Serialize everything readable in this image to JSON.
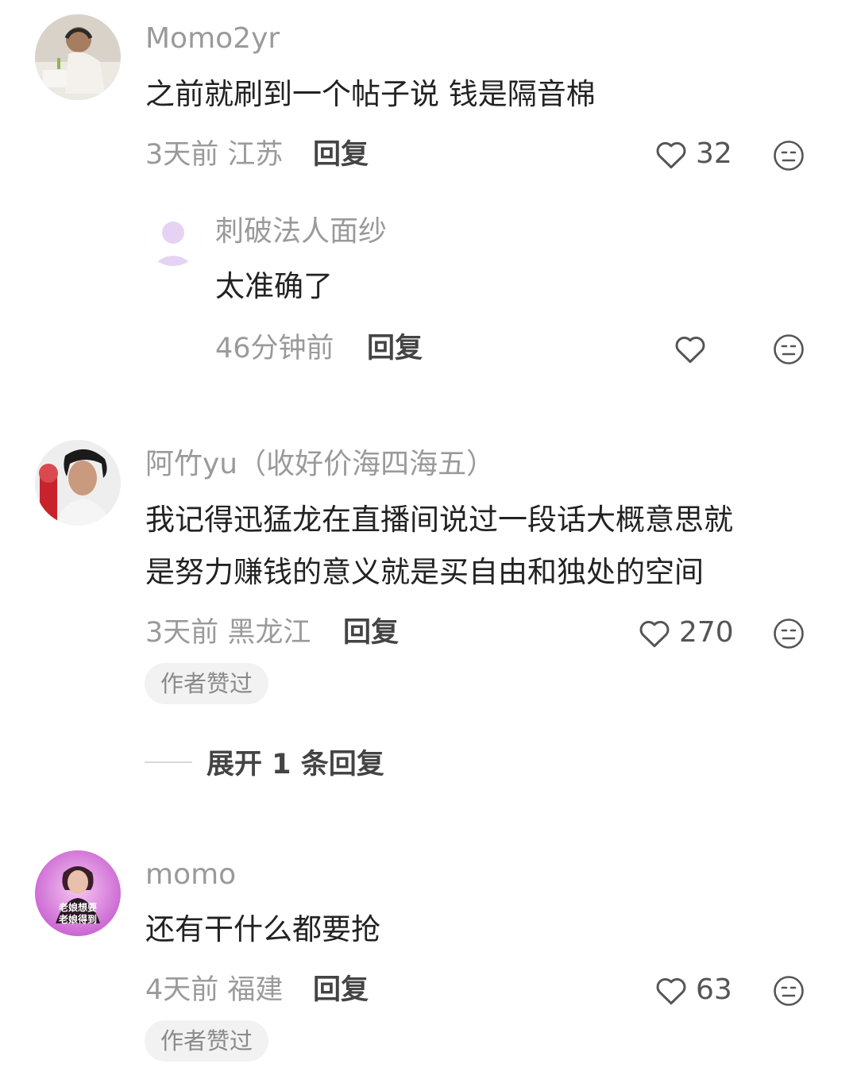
{
  "comments": [
    {
      "username": "Momo2yr",
      "text": "之前就刷到一个帖子说 钱是隔音棉",
      "time_location": "3天前 江苏",
      "reply_label": "回复",
      "likes": "32",
      "avatar": "avatar-photo-person-headphones",
      "reply": {
        "username": "刺破法人面纱",
        "text": "太准确了",
        "time": "46分钟前",
        "reply_label": "回复",
        "likes": "",
        "avatar": "default-avatar-icon"
      }
    },
    {
      "username": "阿竹yu（收好价海四海五）",
      "text_line1": "我记得迅猛龙在直播间说过一段话大概意思就",
      "text_line2": "是努力赚钱的意义就是买自由和独处的空间",
      "time_location": "3天前 黑龙江",
      "reply_label": "回复",
      "likes": "270",
      "badge": "作者赞过",
      "expand_label": "展开 1 条回复",
      "avatar": "avatar-photo-woman"
    },
    {
      "username": "momo",
      "text": "还有干什么都要抢",
      "time_location": "4天前 福建",
      "reply_label": "回复",
      "likes": "63",
      "badge": "作者赞过",
      "avatar": "avatar-sticker-purple",
      "avatar_text_line1": "老娘想要",
      "avatar_text_line2": "老娘得到"
    }
  ],
  "colors": {
    "meta": "#9a9a9a",
    "text": "#222222",
    "badge_bg": "#f2f2f2"
  }
}
